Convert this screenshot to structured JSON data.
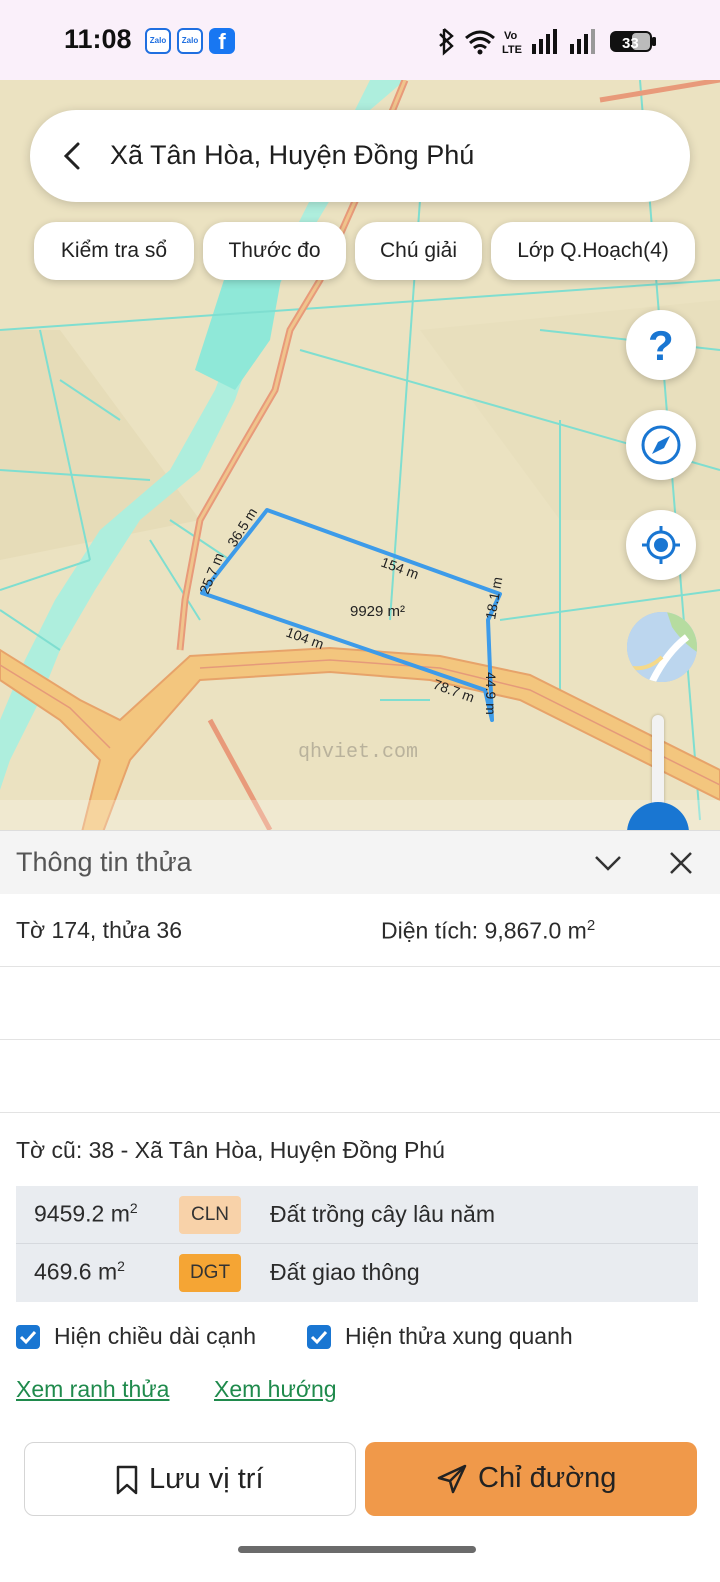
{
  "status_bar": {
    "time": "11:08",
    "left_icons": [
      "zalo-icon",
      "zalo-icon",
      "facebook-icon"
    ],
    "right_icons": [
      "bluetooth-icon",
      "wifi-icon",
      "volte-icon",
      "signal-icon",
      "signal-icon",
      "battery-icon"
    ],
    "volte_label": "Vo\nLTE",
    "battery_level": "33"
  },
  "search": {
    "title": "Xã Tân Hòa, Huyện Đồng Phú"
  },
  "chips": [
    {
      "label": "Kiểm tra sổ"
    },
    {
      "label": "Thước đo"
    },
    {
      "label": "Chú giải"
    },
    {
      "label": "Lớp Q.Hoạch(4)"
    }
  ],
  "map": {
    "area_label": "9929 m²",
    "edges": [
      "154 m",
      "18.1 m",
      "44.9 m",
      "78.7 m",
      "104 m",
      "25.7 m",
      "36.5 m"
    ],
    "watermark": "qhviet.com",
    "parcel_color": "#3d9be9",
    "road_color": "#e8b36a"
  },
  "map_controls": [
    "help-icon",
    "compass-icon",
    "my-location-icon",
    "map-layer-icon"
  ],
  "sheet": {
    "title": "Thông tin thửa",
    "parcel": "Tờ 174, thửa 36",
    "area_label": "Diện tích: 9,867.0 m",
    "area_sup": "2",
    "old_sheet": "Tờ cũ: 38 - Xã Tân Hòa, Huyện Đồng Phú",
    "land_uses": [
      {
        "area": "9459.2 m",
        "sup": "2",
        "code": "CLN",
        "code_color": "#f8d2a9",
        "desc": "Đất trồng cây lâu năm"
      },
      {
        "area": "469.6 m",
        "sup": "2",
        "code": "DGT",
        "code_color": "#f5a534",
        "desc": "Đất giao thông"
      }
    ],
    "checkboxes": [
      {
        "label": "Hiện chiều dài cạnh",
        "checked": true
      },
      {
        "label": "Hiện thửa xung quanh",
        "checked": true
      }
    ],
    "links": [
      "Xem ranh thửa",
      "Xem hướng"
    ],
    "save_label": "Lưu vị trí",
    "directions_label": "Chỉ đường",
    "accent_color": "#f0994a"
  }
}
